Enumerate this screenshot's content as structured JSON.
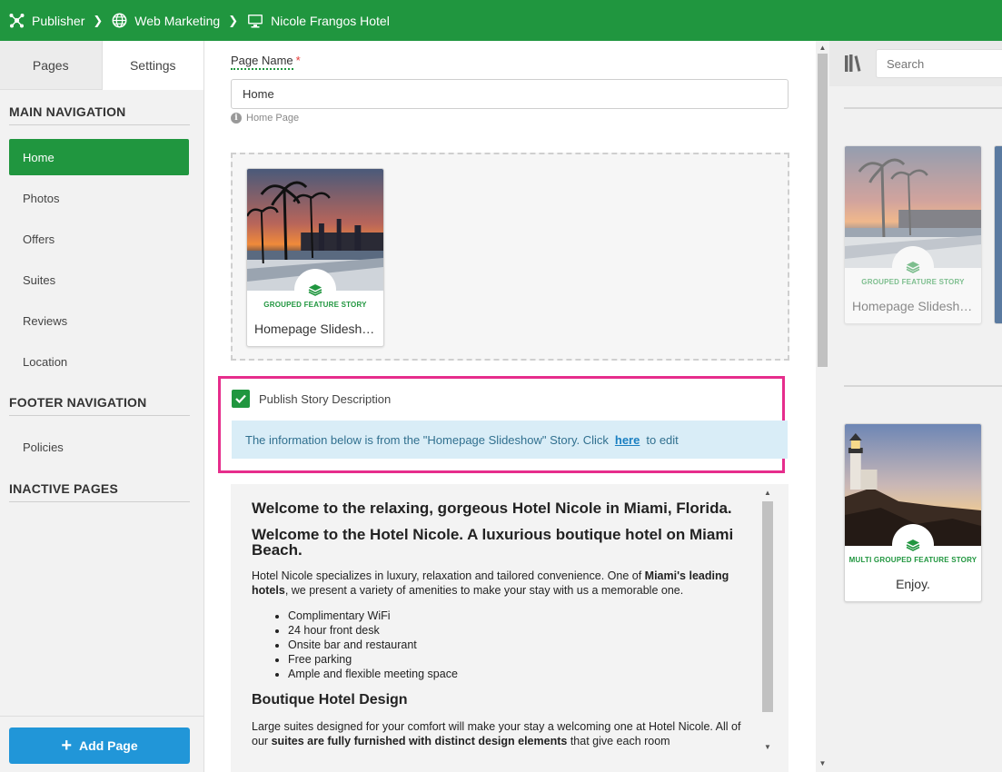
{
  "breadcrumb": {
    "items": [
      {
        "label": "Publisher",
        "icon": "hub-icon"
      },
      {
        "label": "Web Marketing",
        "icon": "globe-icon"
      },
      {
        "label": "Nicole Frangos Hotel",
        "icon": "monitor-icon"
      }
    ]
  },
  "sidebar": {
    "tabs": [
      {
        "label": "Pages",
        "active": false
      },
      {
        "label": "Settings",
        "active": true
      }
    ],
    "main_nav_title": "MAIN NAVIGATION",
    "main_nav": [
      "Home",
      "Photos",
      "Offers",
      "Suites",
      "Reviews",
      "Location"
    ],
    "active_item": "Home",
    "footer_nav_title": "FOOTER NAVIGATION",
    "footer_nav": [
      "Policies"
    ],
    "inactive_title": "INACTIVE PAGES",
    "add_page_label": "Add Page"
  },
  "form": {
    "page_name_label": "Page Name",
    "required_mark": "*",
    "page_name_value": "Home",
    "hint": "Home Page"
  },
  "dropzone_card": {
    "kind": "GROUPED FEATURE STORY",
    "title": "Homepage Slideshow"
  },
  "publish": {
    "checkbox_label": "Publish Story Description",
    "checked": true,
    "info_prefix": "The information below is from the \"Homepage Slideshow\" Story. Click",
    "info_link": "here",
    "info_suffix": "to edit"
  },
  "preview": {
    "heading1": "Welcome to the relaxing, gorgeous Hotel Nicole in Miami, Florida.",
    "heading2": "Welcome to the Hotel Nicole. A luxurious boutique hotel on Miami Beach.",
    "para1_a": "Hotel Nicole specializes in luxury, relaxation and tailored convenience. One of",
    "para1_bold": "Miami's leading hotels",
    "para1_b": ", we present a variety of amenities to make your stay with us a memorable one.",
    "amenities": [
      "Complimentary WiFi",
      "24 hour front desk",
      "Onsite bar and restaurant",
      "Free parking",
      "Ample and flexible meeting space"
    ],
    "heading3": "Boutique Hotel Design",
    "para2_a": "Large suites designed for your comfort will make your stay a welcoming one at Hotel Nicole. All of our",
    "para2_bold": "suites are fully furnished with distinct design elements",
    "para2_b": "that give each room"
  },
  "library": {
    "search_placeholder": "Search",
    "cards": [
      {
        "kind": "GROUPED FEATURE STORY",
        "title": "Homepage Slideshow"
      },
      {
        "kind": "MULTI GROUPED FEATURE STORY",
        "title": "Enjoy."
      }
    ]
  },
  "colors": {
    "brand_green": "#20963f",
    "add_button_blue": "#2196d8",
    "highlight_pink": "#e62d8c",
    "info_bg": "#d9edf7"
  }
}
